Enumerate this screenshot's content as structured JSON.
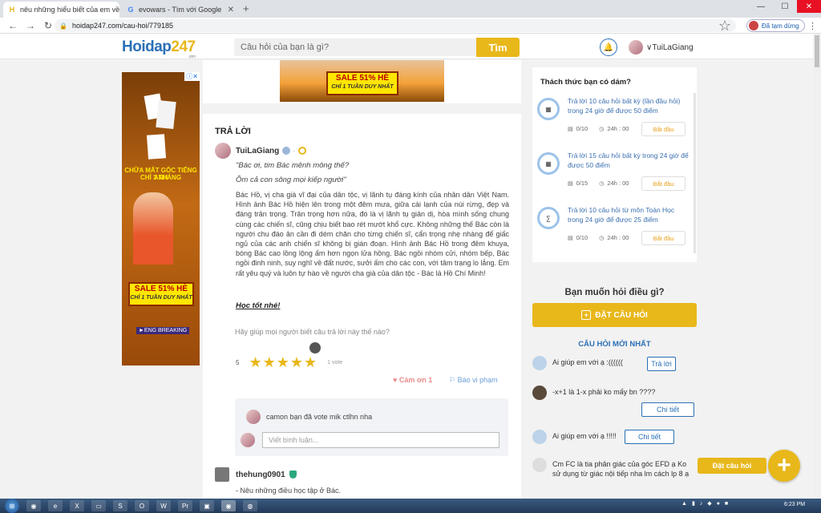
{
  "browser": {
    "tabs": [
      {
        "title": "nêu những hiểu biết của em về c",
        "favicon": "H",
        "active": true
      },
      {
        "title": "evowars - Tìm với Google",
        "favicon": "G",
        "active": false
      }
    ],
    "url": "hoidap247.com/cau-hoi/779185",
    "incognito_label": "Đã tạm dừng"
  },
  "header": {
    "logo_main": "Hoidap",
    "logo_num": "247",
    "logo_sub": ".com",
    "search_placeholder": "Câu hỏi của bạn là gì?",
    "search_button": "Tìm",
    "username": "TuiLaGiang"
  },
  "ads": {
    "left_close": "ⓘ✕",
    "left_headline1": "CHỮA MẤT GỐC TIẾNG ANH",
    "left_headline2": "CHỈ 3 THÁNG",
    "sale_title": "SALE 51% HÈ",
    "sale_sub": "CHỈ 1 TUẦN DUY NHẤT",
    "brand": "►ENG BREAKING"
  },
  "answer": {
    "section_title": "TRẢ LỜI",
    "author": "TuiLaGiang",
    "quote1": "\"Bác ơi, tim Bác mênh mông thế?",
    "quote2": "Ôm cả con sông mọi kiếp người\"",
    "body": "Bác Hồ, vị cha già vĩ đại của dân tộc, vị lãnh tụ đáng kính của nhân dân Việt Nam. Hình ảnh Bác Hồ hiện lên trong một đêm mưa, giữa cái lạnh của núi rừng, đẹp và đáng trân trọng. Trân trọng hơn nữa, đó là vị lãnh tụ giản dị, hòa mình sống chung cùng các chiến sĩ, cũng chịu biết bao rét mướt khổ cực. Không những thế Bác còn là người chu đáo ân cần đi dém chăn cho từng chiến sĩ, cẩn trọng nhẹ nhàng để giấc ngủ của các anh chiến sĩ không bị gián đoạn. Hình ảnh Bác Hồ trong đêm khuya, bóng Bác cao lồng lộng ấm hơn ngọn lửa hồng. Bác ngồi nhóm cửi, nhóm bếp, Bác ngồi đinh ninh, suy nghĩ về đất nước, sưởi ấm cho các con, với tâm trạng lo lắng. Em rất yêu quý và luôn tự hào về người cha già của dân tộc - Bác là Hồ Chí Minh!",
    "signoff": "Học tốt nhé!",
    "help_text": "Hãy giúp mọi người biết câu trả lời này thế nào?",
    "rating_value": "5",
    "stars": 5,
    "votes": "1 vote",
    "thanks": "♥ Cảm ơn 1",
    "report": "⚐ Báo vi phạm",
    "comment": "camon bạn đã vote mik ctlhn nha",
    "comment_placeholder": "Viết bình luận..."
  },
  "answer2": {
    "author": "thehung0901",
    "text": "- Nêu những điều học tập ở Bác."
  },
  "challenge": {
    "title": "Thách thức bạn có dám?",
    "items": [
      {
        "text": "Trả lời 10 câu hỏi  bất kỳ (lần đầu hỏi) trong 24 giờ để được 50 điểm",
        "progress": "0/10",
        "time": "24h : 00",
        "button": "Bắt đầu",
        "icon": "grid-icon"
      },
      {
        "text": "Trả lời 15 câu hỏi  bất kỳ  trong 24 giờ để được 50 điểm",
        "progress": "0/15",
        "time": "24h : 00",
        "button": "Bắt đầu",
        "icon": "grid-icon"
      },
      {
        "text": "Trả lời 10 câu hỏi  từ môn Toán Học trong 24 giờ để được 25 điểm",
        "progress": "0/10",
        "time": "24h : 00",
        "button": "Bắt đầu",
        "icon": "math-icon"
      }
    ]
  },
  "ask": {
    "title": "Bạn muốn hỏi điều gì?",
    "button": "ĐẶT CÂU HỎI"
  },
  "new_questions": {
    "title": "CÂU HỎI MỚI NHẤT",
    "items": [
      {
        "text": "Ai giúp em với ạ :((((((",
        "button": "Trả lời"
      },
      {
        "text": "-x+1 là 1-x phải ko mấy bn ????",
        "button": "Chi tiết"
      },
      {
        "text": "Ai giúp em với ạ !!!!!",
        "button": "Chi tiết"
      },
      {
        "text": "Cm FC là tia phân giác của góc EFD ạ Ko sử dụng từ giác nội tiếp nha lm cách lp 8 ạ",
        "button": ""
      }
    ]
  },
  "fab": {
    "label": "Đặt câu hỏi",
    "symbol": "+"
  },
  "taskbar": {
    "clock": "6:23 PM"
  }
}
